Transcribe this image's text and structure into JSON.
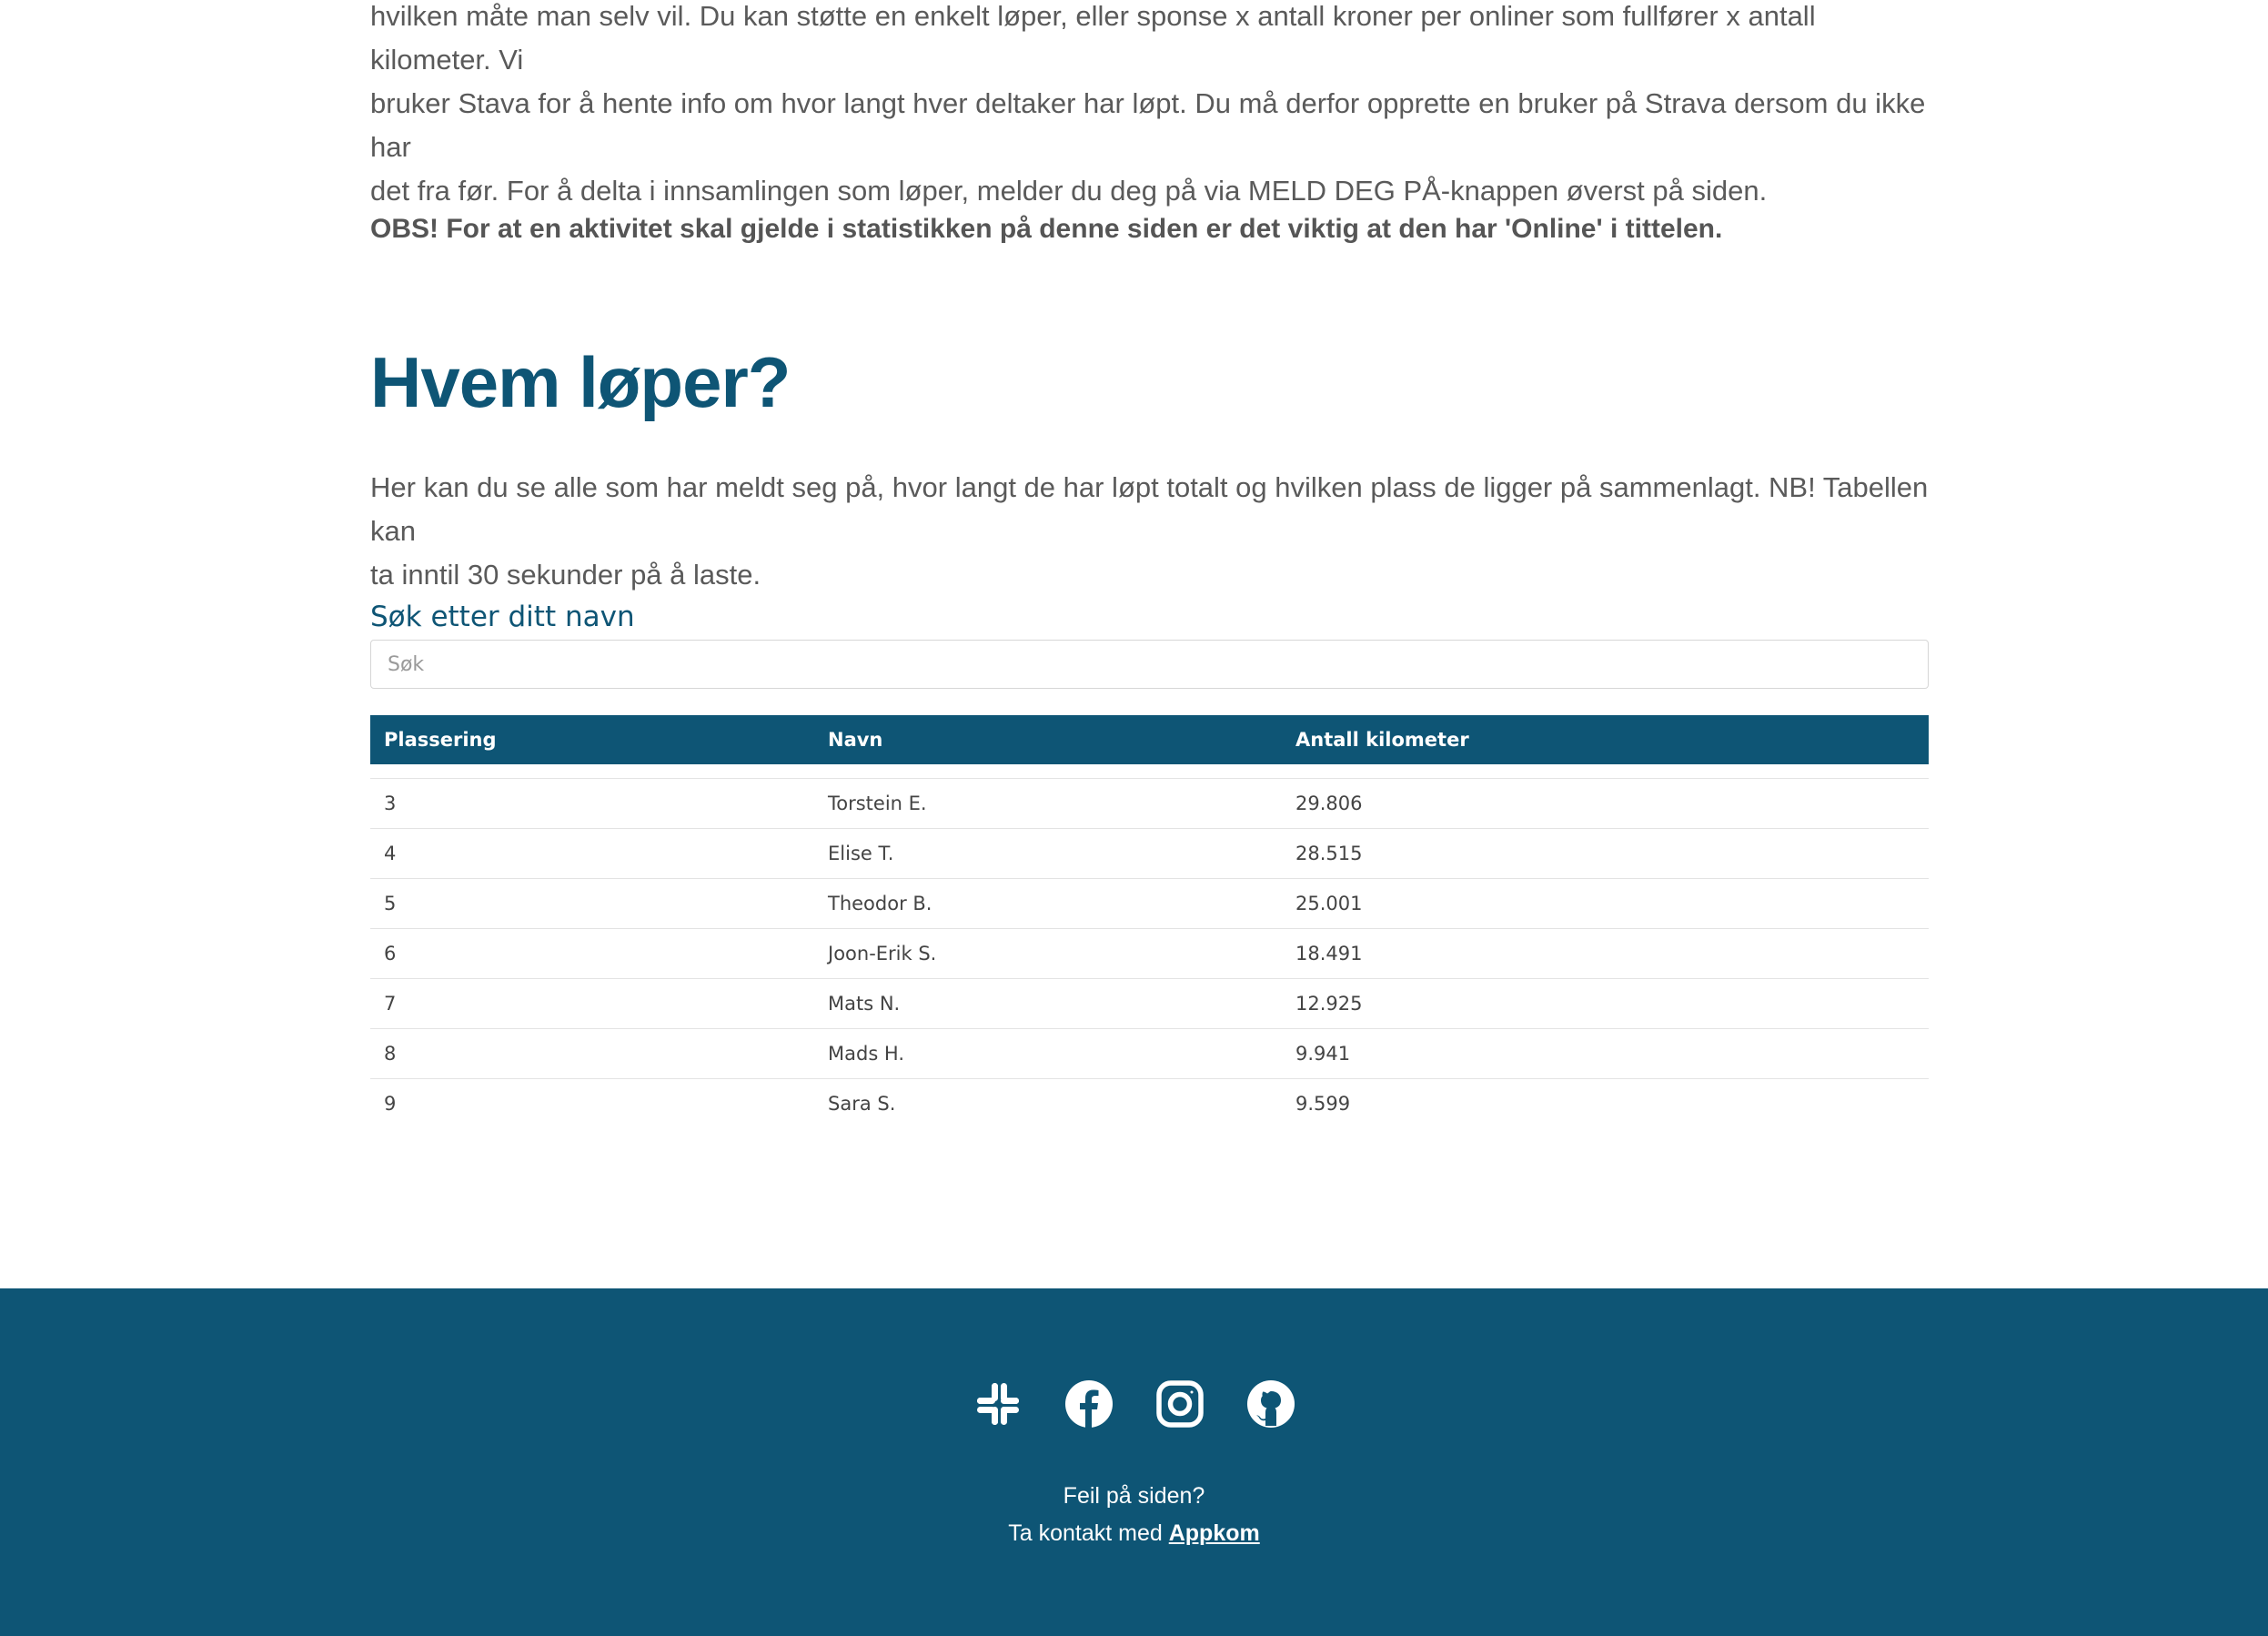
{
  "intro": {
    "line1": "hvilken måte man selv vil. Du kan støtte en enkelt løper, eller sponse x antall kroner per onliner som fullfører x antall kilometer. Vi",
    "line2": "bruker Stava for å hente info om hvor langt hver deltaker har løpt. Du må derfor opprette en bruker på Strava dersom du ikke har",
    "line3": "det fra før. For å delta i innsamlingen som løper, melder du deg på via MELD DEG PÅ-knappen øverst på siden."
  },
  "obs_note": "OBS! For at en aktivitet skal gjelde i statistikken på denne siden er det viktig at den har 'Online' i tittelen.",
  "section": {
    "title": "Hvem løper?",
    "lead_line1": "Her kan du se alle som har meldt seg på, hvor langt de har løpt totalt og hvilken plass de ligger på sammenlagt. NB! Tabellen kan",
    "lead_line2": "ta inntil 30 sekunder på å laste."
  },
  "search": {
    "label": "Søk etter ditt navn",
    "placeholder": "Søk",
    "value": ""
  },
  "table": {
    "headers": [
      "Plassering",
      "Navn",
      "Antall kilometer"
    ],
    "rows": [
      {
        "place": "3",
        "name": "Torstein E.",
        "km": "29.806"
      },
      {
        "place": "4",
        "name": "Elise T.",
        "km": "28.515"
      },
      {
        "place": "5",
        "name": "Theodor B.",
        "km": "25.001"
      },
      {
        "place": "6",
        "name": "Joon-Erik S.",
        "km": "18.491"
      },
      {
        "place": "7",
        "name": "Mats N.",
        "km": "12.925"
      },
      {
        "place": "8",
        "name": "Mads H.",
        "km": "9.941"
      },
      {
        "place": "9",
        "name": "Sara S.",
        "km": "9.599"
      }
    ]
  },
  "footer": {
    "socials": [
      "slack-icon",
      "facebook-icon",
      "instagram-icon",
      "github-icon"
    ],
    "error_text": "Feil på siden?",
    "contact_prefix": "Ta kontakt med ",
    "contact_link": "Appkom"
  },
  "colors": {
    "primary": "#0e5575",
    "text": "#5a5a5a",
    "white": "#ffffff"
  }
}
